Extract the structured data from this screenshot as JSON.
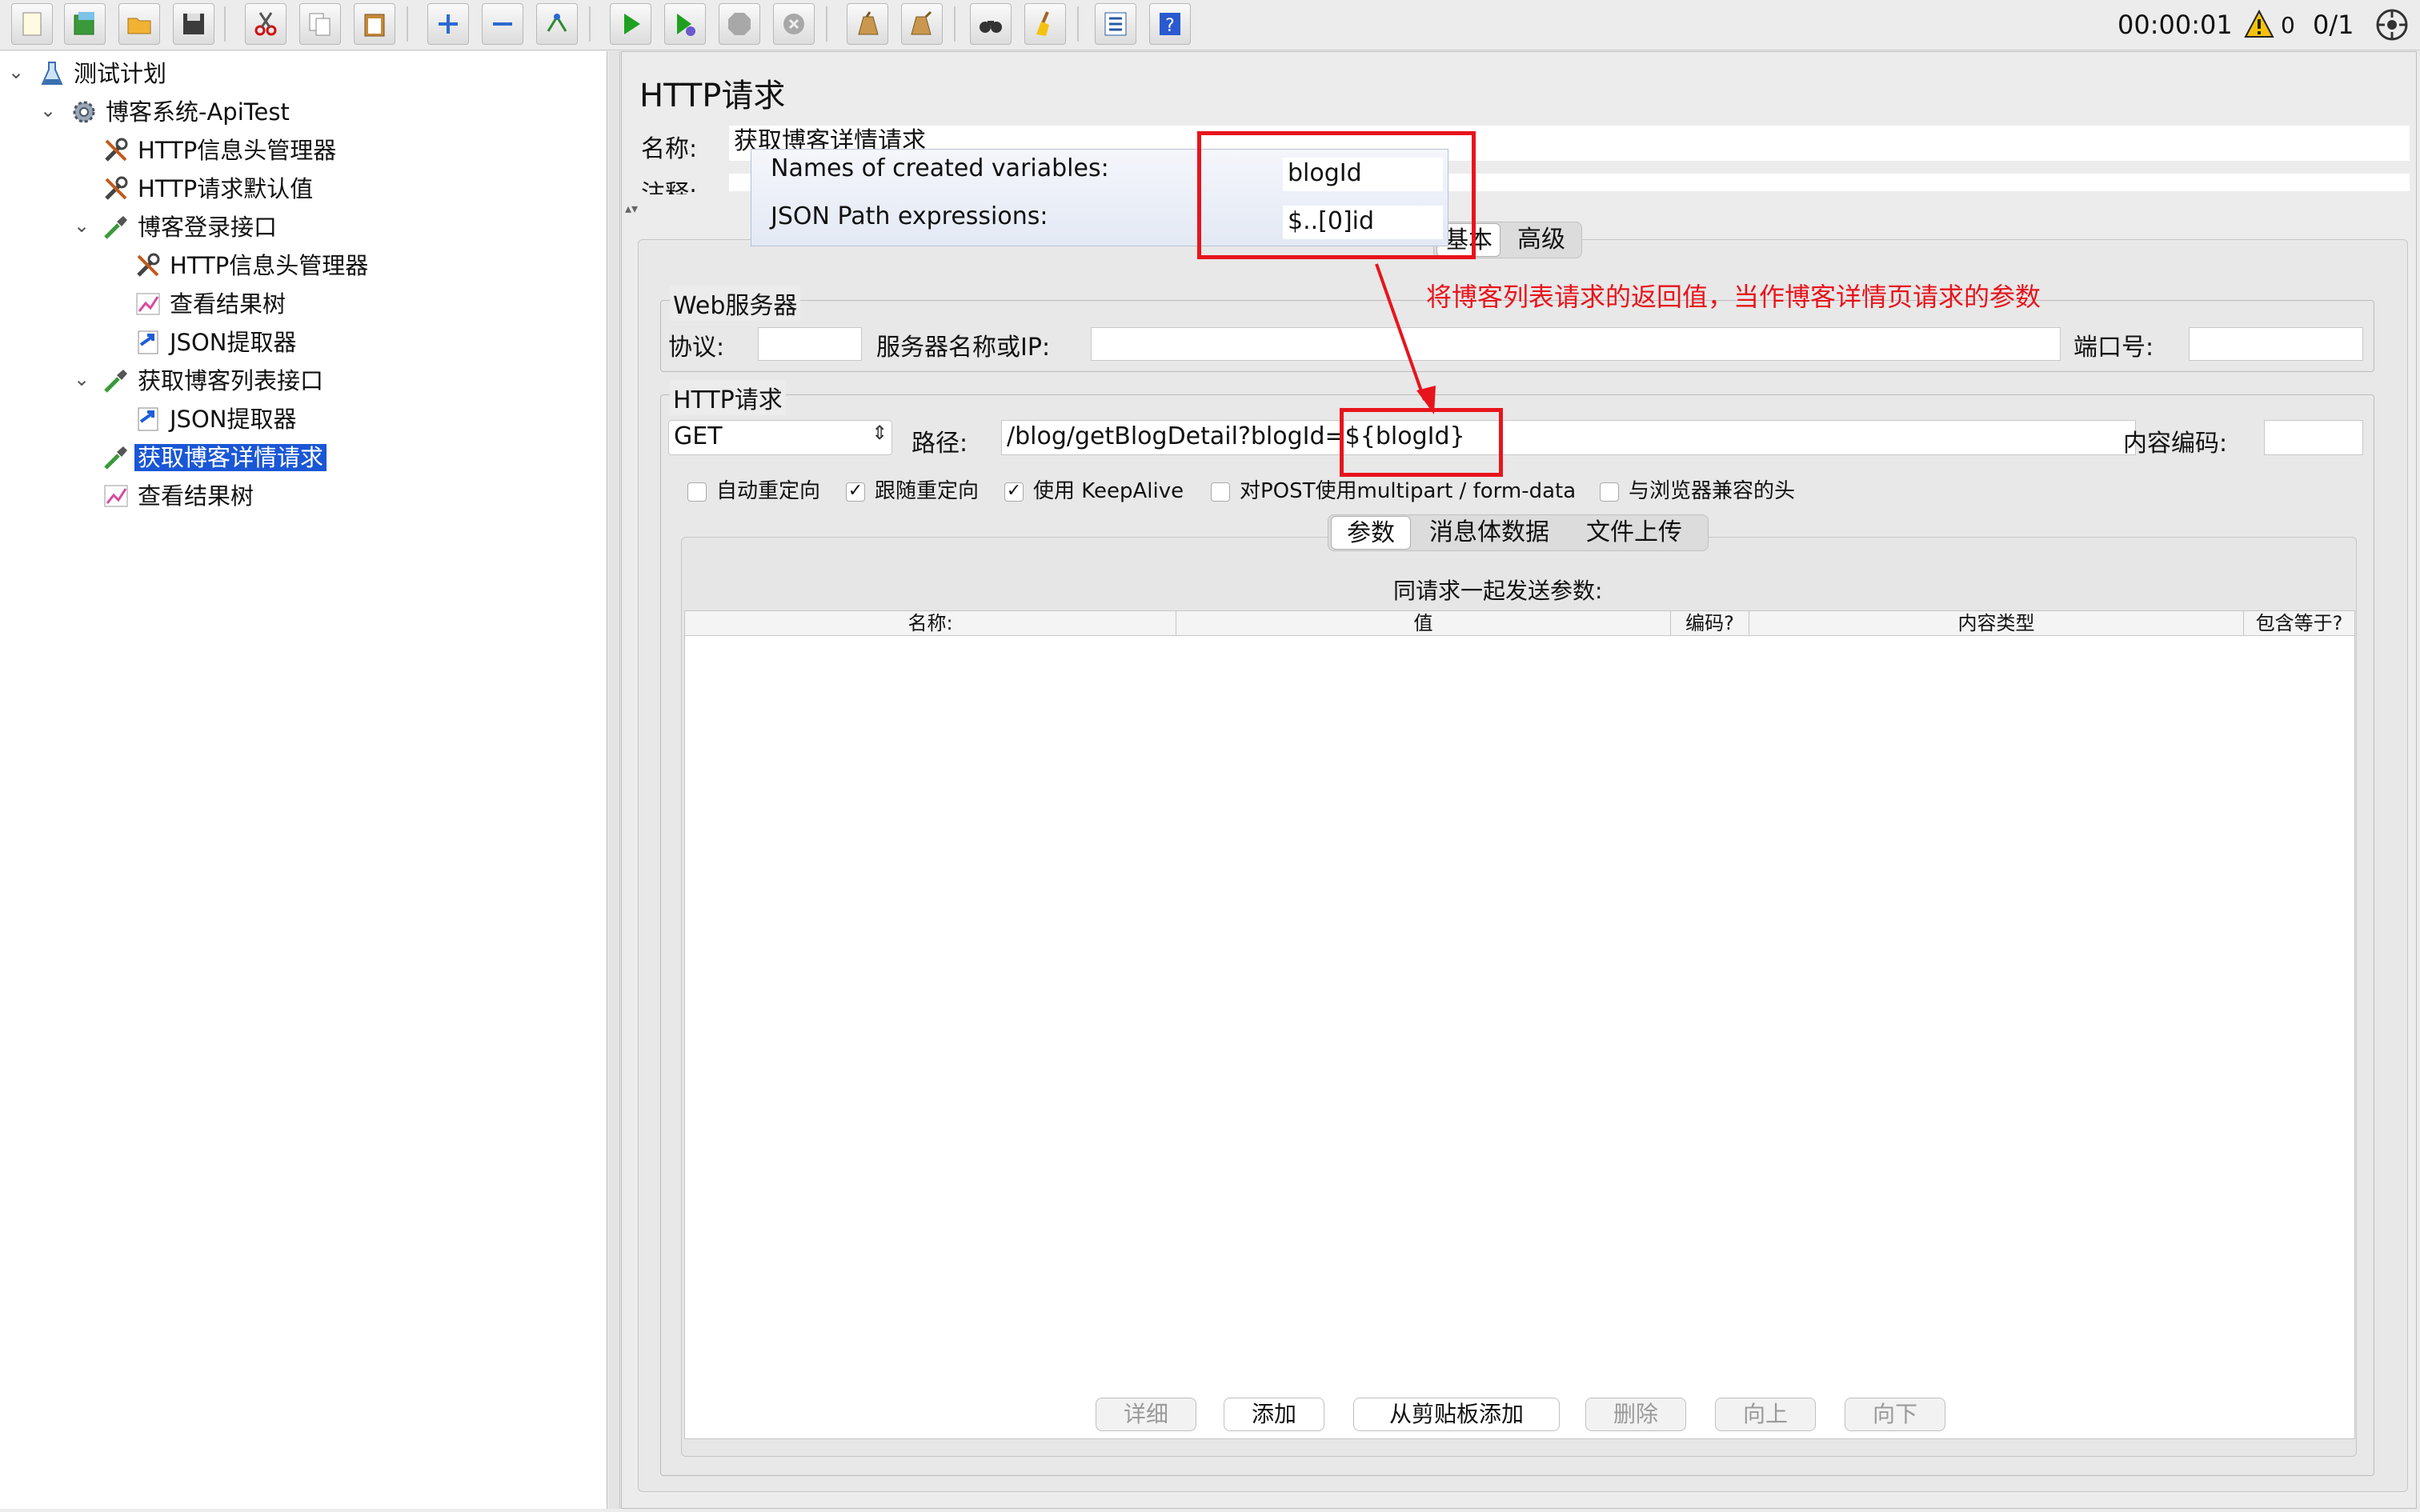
{
  "toolbar": {
    "icons": [
      "new-icon",
      "templates-icon",
      "open-icon",
      "save-icon",
      "cut-icon",
      "copy-icon",
      "paste-icon",
      "expand-icon",
      "collapse-icon",
      "toggle-icon",
      "start-icon",
      "start-no-pause-icon",
      "stop-icon",
      "shutdown-icon",
      "clear-icon",
      "clear-all-icon",
      "search-icon",
      "reset-search-icon",
      "function-helper-icon",
      "help-icon"
    ],
    "timer": "00:00:01",
    "warnings": "0",
    "threads": "0/1"
  },
  "tree": {
    "items": [
      {
        "label": "测试计划",
        "icon": "flask-icon"
      },
      {
        "label": "博客系统-ApiTest",
        "icon": "gear-icon"
      },
      {
        "label": "HTTP信息头管理器",
        "icon": "wrench-icon"
      },
      {
        "label": "HTTP请求默认值",
        "icon": "wrench-icon"
      },
      {
        "label": "博客登录接口",
        "icon": "pipette-icon"
      },
      {
        "label": "HTTP信息头管理器",
        "icon": "wrench-icon"
      },
      {
        "label": "查看结果树",
        "icon": "graph-icon"
      },
      {
        "label": "JSON提取器",
        "icon": "extractor-icon"
      },
      {
        "label": "获取博客列表接口",
        "icon": "pipette-icon"
      },
      {
        "label": "JSON提取器",
        "icon": "extractor-icon"
      },
      {
        "label": "获取博客详情请求",
        "icon": "pipette-icon"
      },
      {
        "label": "查看结果树",
        "icon": "graph-icon"
      }
    ]
  },
  "main": {
    "title": "HTTP请求",
    "name_label": "名称:",
    "name_value": "获取博客详情请求",
    "comment_label": "注释:",
    "tabs": [
      "基本",
      "高级"
    ]
  },
  "overlay": {
    "vars_label": "Names of created variables:",
    "vars_value": "blogId",
    "json_label": "JSON Path expressions:",
    "json_value": "$..[0]id"
  },
  "annotation": {
    "text": "将博客列表请求的返回值，当作博客详情页请求的参数",
    "color": "#e8141c"
  },
  "web_server": {
    "title": "Web服务器",
    "protocol_label": "协议:",
    "protocol_value": "",
    "server_label": "服务器名称或IP:",
    "server_value": "",
    "port_label": "端口号:",
    "port_value": ""
  },
  "http_request": {
    "title": "HTTP请求",
    "method": "GET",
    "path_label": "路径:",
    "path_prefix": "/blog/getBlogDetail?blogId",
    "path_param": "=${blogId}",
    "encoding_label": "内容编码:",
    "encoding_value": "",
    "checks": [
      {
        "label": "自动重定向",
        "checked": false,
        "mark": ""
      },
      {
        "label": "跟随重定向",
        "checked": true,
        "mark": "✓"
      },
      {
        "label": "使用 KeepAlive",
        "checked": true,
        "mark": "✓"
      },
      {
        "label": "对POST使用multipart / form-data",
        "checked": false,
        "mark": ""
      },
      {
        "label": "与浏览器兼容的头",
        "checked": false,
        "mark": ""
      }
    ],
    "sub_tabs": [
      "参数",
      "消息体数据",
      "文件上传"
    ],
    "params_title": "同请求一起发送参数:",
    "columns": [
      "名称:",
      "值",
      "编码?",
      "内容类型",
      "包含等于?"
    ],
    "buttons": [
      {
        "label": "详细",
        "enabled": false
      },
      {
        "label": "添加",
        "enabled": true
      },
      {
        "label": "从剪贴板添加",
        "enabled": true
      },
      {
        "label": "删除",
        "enabled": false
      },
      {
        "label": "向上",
        "enabled": false
      },
      {
        "label": "向下",
        "enabled": false
      }
    ]
  }
}
